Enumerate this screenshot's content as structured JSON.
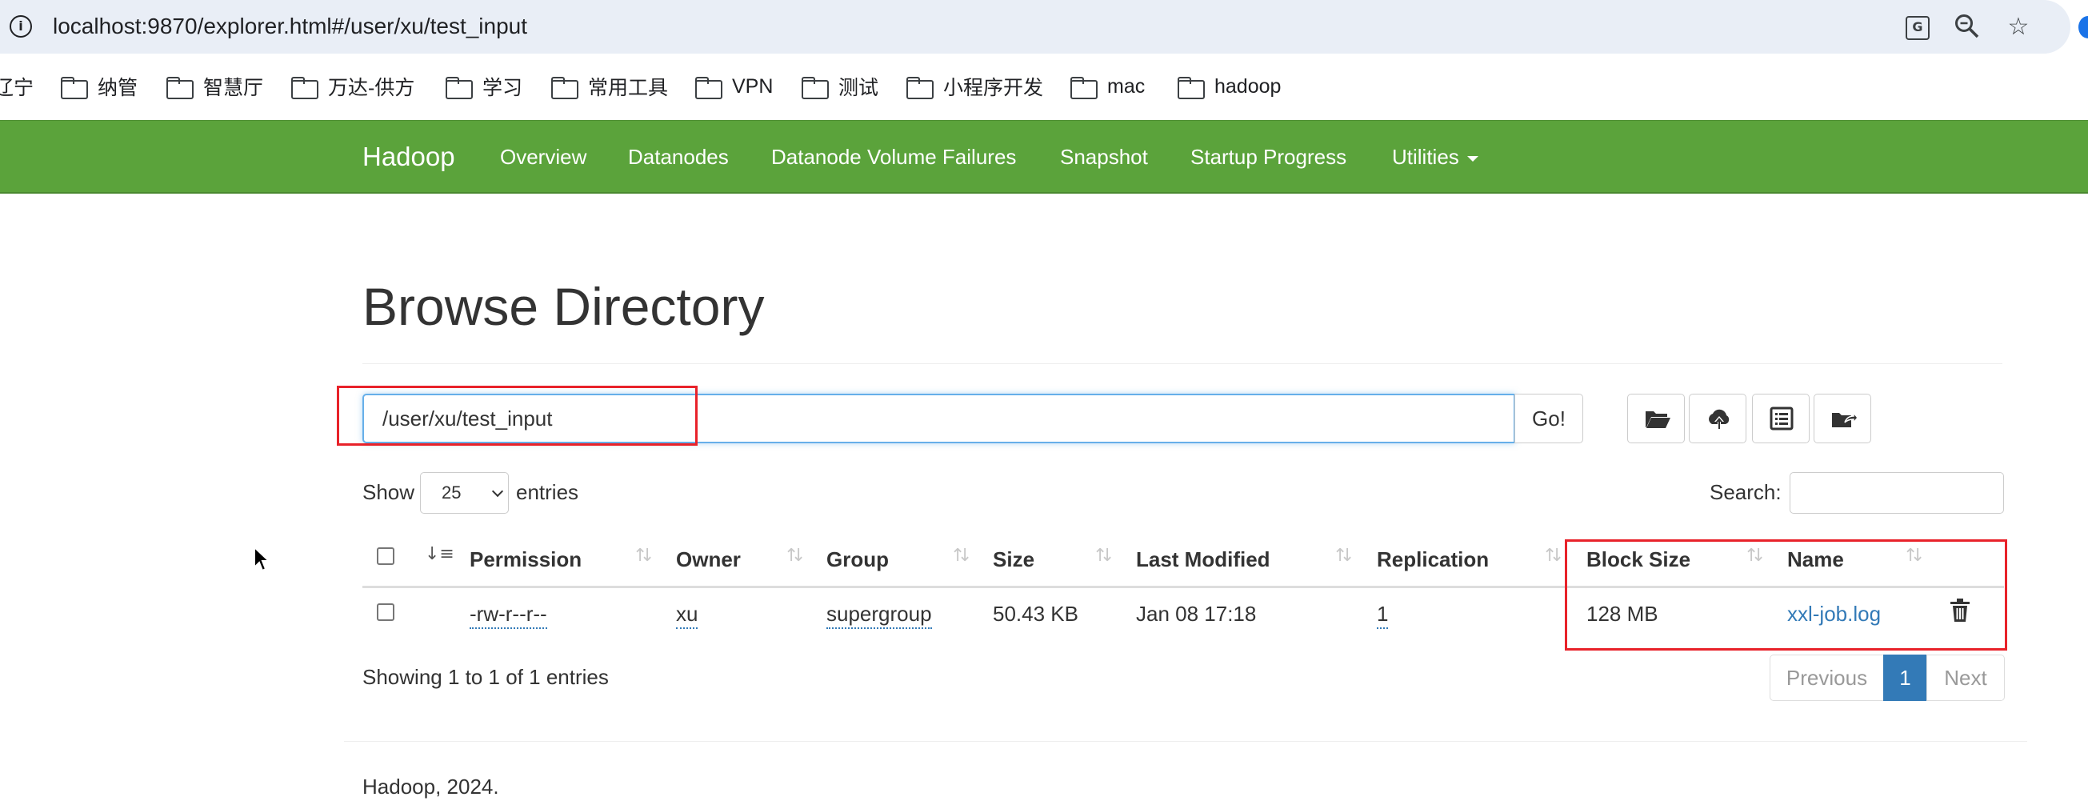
{
  "browser": {
    "url": "localhost:9870/explorer.html#/user/xu/test_input",
    "info_glyph": "i",
    "translate_glyph": "G",
    "zoom_glyph": "⚲",
    "star_glyph": "☆",
    "bookmarks": [
      "辽宁",
      "纳管",
      "智慧厅",
      "万达-供方",
      "学习",
      "常用工具",
      "VPN",
      "测试",
      "小程序开发",
      "mac",
      "hadoop"
    ]
  },
  "navbar": {
    "brand": "Hadoop",
    "items": [
      "Overview",
      "Datanodes",
      "Datanode Volume Failures",
      "Snapshot",
      "Startup Progress",
      "Utilities"
    ],
    "color": "#5ba33b"
  },
  "page": {
    "title": "Browse Directory",
    "path_value": "/user/xu/test_input",
    "go_label": "Go!",
    "show_label": "Show",
    "entries_value": "25",
    "entries_label": "entries",
    "search_label": "Search:"
  },
  "table": {
    "columns": [
      "Permission",
      "Owner",
      "Group",
      "Size",
      "Last Modified",
      "Replication",
      "Block Size",
      "Name"
    ],
    "sort_glyph": "↓≡",
    "rows": [
      {
        "permission": "-rw-r--r--",
        "owner": "xu",
        "group": "supergroup",
        "size": "50.43 KB",
        "last_modified": "Jan 08 17:18",
        "replication": "1",
        "block_size": "128 MB",
        "name": "xxl-job.log"
      }
    ]
  },
  "pagination": {
    "info": "Showing 1 to 1 of 1 entries",
    "previous": "Previous",
    "current": "1",
    "next": "Next"
  },
  "footer": {
    "text": "Hadoop, 2024."
  },
  "colors": {
    "accent_blue": "#337ab7",
    "annotation_red": "#e8222a"
  }
}
